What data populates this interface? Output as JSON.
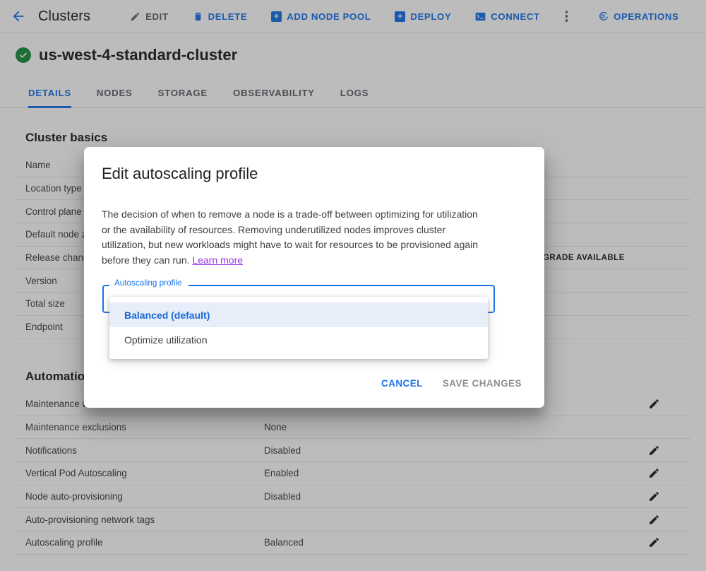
{
  "topbar": {
    "back_icon": "back-arrow-icon",
    "title": "Clusters",
    "actions": [
      {
        "label": "EDIT",
        "icon": "pencil-icon",
        "disabled": true
      },
      {
        "label": "DELETE",
        "icon": "trash-icon",
        "disabled": false
      },
      {
        "label": "ADD NODE POOL",
        "icon": "plus-square-icon",
        "disabled": false
      },
      {
        "label": "DEPLOY",
        "icon": "plus-square-icon",
        "disabled": false
      },
      {
        "label": "CONNECT",
        "icon": "terminal-icon",
        "disabled": false
      }
    ],
    "overflow_icon": "kebab-menu-icon",
    "operations": {
      "label": "OPERATIONS",
      "icon": "operations-icon"
    }
  },
  "cluster": {
    "status_icon": "check-circle-icon",
    "name": "us-west-4-standard-cluster"
  },
  "tabs": [
    {
      "label": "DETAILS",
      "active": true
    },
    {
      "label": "NODES",
      "active": false
    },
    {
      "label": "STORAGE",
      "active": false
    },
    {
      "label": "OBSERVABILITY",
      "active": false
    },
    {
      "label": "LOGS",
      "active": false
    }
  ],
  "sections": [
    {
      "title": "Cluster basics",
      "rows": [
        {
          "key": "Name",
          "value": "",
          "badge": "",
          "edit": false
        },
        {
          "key": "Location type",
          "value": "",
          "badge": "",
          "edit": false
        },
        {
          "key": "Control plane zone",
          "value": "",
          "badge": "",
          "edit": false
        },
        {
          "key": "Default node zones",
          "value": "",
          "badge": "",
          "edit": false
        },
        {
          "key": "Release channel",
          "value": "",
          "badge": "UPGRADE AVAILABLE",
          "edit": false
        },
        {
          "key": "Version",
          "value": "",
          "badge": "",
          "edit": false
        },
        {
          "key": "Total size",
          "value": "",
          "badge": "",
          "edit": false
        },
        {
          "key": "Endpoint",
          "value": "",
          "badge": "",
          "edit": false
        }
      ]
    },
    {
      "title": "Automation",
      "rows": [
        {
          "key": "Maintenance window",
          "value": "",
          "badge": "",
          "edit": true
        },
        {
          "key": "Maintenance exclusions",
          "value": "None",
          "badge": "",
          "edit": false
        },
        {
          "key": "Notifications",
          "value": "Disabled",
          "badge": "",
          "edit": true
        },
        {
          "key": "Vertical Pod Autoscaling",
          "value": "Enabled",
          "badge": "",
          "edit": true
        },
        {
          "key": "Node auto-provisioning",
          "value": "Disabled",
          "badge": "",
          "edit": true
        },
        {
          "key": "Auto-provisioning network tags",
          "value": "",
          "badge": "",
          "edit": true
        },
        {
          "key": "Autoscaling profile",
          "value": "Balanced",
          "badge": "",
          "edit": true
        }
      ]
    }
  ],
  "dialog": {
    "title": "Edit autoscaling profile",
    "body_text": "The decision of when to remove a node is a trade-off between optimizing for utilization or the availability of resources. Removing underutilized nodes improves cluster utilization, but new workloads might have to wait for resources to be provisioned again before they can run. ",
    "learn_more": "Learn more",
    "field": {
      "label": "Autoscaling profile",
      "selected": "Balanced (default)",
      "options": [
        {
          "label": "Balanced (default)",
          "selected": true
        },
        {
          "label": "Optimize utilization",
          "selected": false
        }
      ]
    },
    "cancel_label": "CANCEL",
    "save_label": "SAVE CHANGES",
    "save_disabled": true
  },
  "colors": {
    "accent": "#1a73e8",
    "status_ok": "#1e8e3e",
    "link_visited": "#9334e6",
    "option_selected_bg": "#e8eef9"
  }
}
